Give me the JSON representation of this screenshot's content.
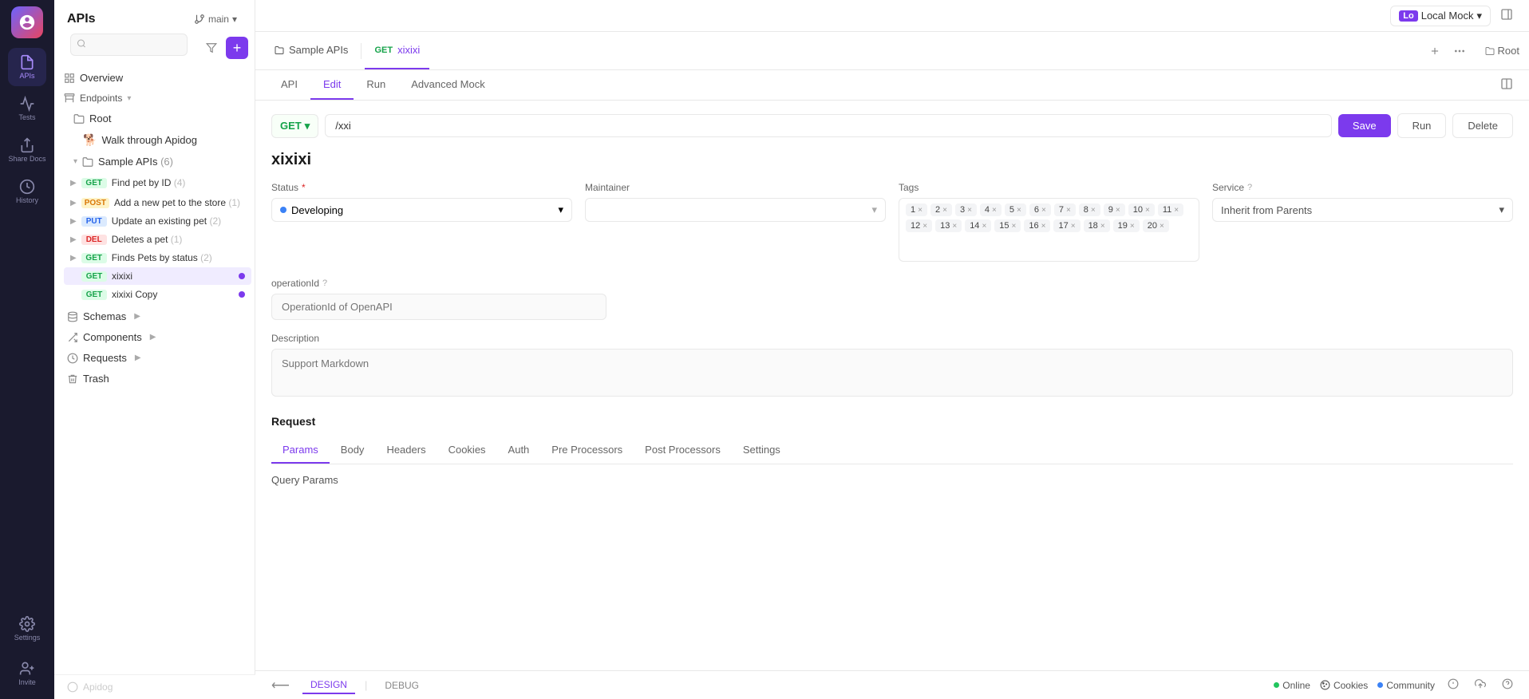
{
  "app": {
    "title": "APIs"
  },
  "icon_sidebar": {
    "items": [
      {
        "id": "apis",
        "label": "APIs",
        "icon": "api-icon",
        "active": true
      },
      {
        "id": "tests",
        "label": "Tests",
        "icon": "test-icon",
        "active": false
      },
      {
        "id": "share-docs",
        "label": "Share Docs",
        "icon": "share-icon",
        "active": false
      },
      {
        "id": "history",
        "label": "History",
        "icon": "history-icon",
        "active": false
      },
      {
        "id": "settings",
        "label": "Settings",
        "icon": "settings-icon",
        "active": false
      },
      {
        "id": "invite",
        "label": "Invite",
        "icon": "invite-icon",
        "active": false
      }
    ]
  },
  "sidebar": {
    "title": "APIs",
    "branch": "main",
    "search_placeholder": "",
    "nav": [
      {
        "id": "overview",
        "label": "Overview",
        "type": "overview"
      },
      {
        "id": "endpoints",
        "label": "Endpoints",
        "type": "section"
      },
      {
        "id": "root",
        "label": "Root",
        "type": "folder"
      },
      {
        "id": "walk-through",
        "label": "Walk through Apidog",
        "type": "endpoint-special"
      },
      {
        "id": "sample-apis",
        "label": "Sample APIs",
        "count": "(6)",
        "type": "folder-open"
      }
    ],
    "endpoints": [
      {
        "id": "find-pet-by-id",
        "method": "GET",
        "label": "Find pet by ID",
        "count": "(4)",
        "active": false
      },
      {
        "id": "add-new-pet",
        "method": "POST",
        "label": "Add a new pet to the store",
        "count": "(1)"
      },
      {
        "id": "update-pet",
        "method": "PUT",
        "label": "Update an existing pet",
        "count": "(2)"
      },
      {
        "id": "delete-pet",
        "method": "DEL",
        "label": "Deletes a pet",
        "count": "(1)"
      },
      {
        "id": "find-pets-status",
        "method": "GET",
        "label": "Finds Pets by status",
        "count": "(2)"
      },
      {
        "id": "xixixi",
        "method": "GET",
        "label": "xixixi",
        "active": true
      },
      {
        "id": "xixixi-copy",
        "method": "GET",
        "label": "xixixi Copy"
      }
    ],
    "lower_nav": [
      {
        "id": "schemas",
        "label": "Schemas"
      },
      {
        "id": "components",
        "label": "Components"
      },
      {
        "id": "requests",
        "label": "Requests"
      },
      {
        "id": "trash",
        "label": "Trash"
      }
    ],
    "footer": "Apidog"
  },
  "top_bar": {
    "tabs": [
      {
        "id": "sample-apis",
        "label": "Sample APIs",
        "type": "folder"
      },
      {
        "id": "xixixi",
        "label": "xixixi",
        "method": "GET",
        "type": "api"
      }
    ],
    "breadcrumb_root": "Root"
  },
  "api_tabs": [
    {
      "id": "api",
      "label": "API"
    },
    {
      "id": "edit",
      "label": "Edit",
      "active": true
    },
    {
      "id": "run",
      "label": "Run"
    },
    {
      "id": "advanced-mock",
      "label": "Advanced Mock"
    }
  ],
  "url_bar": {
    "method": "GET",
    "url": "/xxi",
    "save_label": "Save",
    "run_label": "Run",
    "delete_label": "Delete"
  },
  "api_form": {
    "name": "xixixi",
    "status": {
      "label": "Status",
      "value": "Developing"
    },
    "maintainer": {
      "label": "Maintainer",
      "value": ""
    },
    "tags": {
      "label": "Tags",
      "items": [
        "1",
        "2",
        "3",
        "4",
        "5",
        "6",
        "7",
        "8",
        "9",
        "10",
        "11",
        "12",
        "13",
        "14",
        "15",
        "16",
        "17",
        "18",
        "19",
        "20"
      ]
    },
    "service": {
      "label": "Service",
      "value": "Inherit from Parents"
    },
    "operation_id": {
      "label": "operationId",
      "placeholder": "OperationId of OpenAPI"
    },
    "description": {
      "label": "Description",
      "placeholder": "Support Markdown"
    }
  },
  "request_section": {
    "title": "Request",
    "tabs": [
      {
        "id": "params",
        "label": "Params",
        "active": true
      },
      {
        "id": "body",
        "label": "Body"
      },
      {
        "id": "headers",
        "label": "Headers"
      },
      {
        "id": "cookies",
        "label": "Cookies"
      },
      {
        "id": "auth",
        "label": "Auth"
      },
      {
        "id": "pre-processors",
        "label": "Pre Processors"
      },
      {
        "id": "post-processors",
        "label": "Post Processors"
      },
      {
        "id": "settings",
        "label": "Settings"
      }
    ],
    "query_params_label": "Query Params"
  },
  "global_env": {
    "label": "Local Mock",
    "logo": "Lo"
  },
  "bottom_bar": {
    "design_label": "DESIGN",
    "debug_label": "DEBUG",
    "online_label": "Online",
    "cookies_label": "Cookies",
    "community_label": "Community"
  }
}
